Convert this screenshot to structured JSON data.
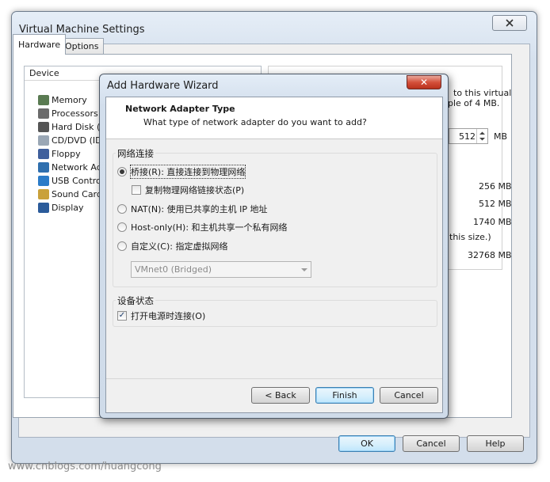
{
  "window": {
    "title": "Virtual Machine Settings",
    "tabs": [
      "Hardware",
      "Options"
    ],
    "device_header": "Device",
    "devices": [
      {
        "label": "Memory",
        "icon": "memory-icon",
        "color": "#5a7b52"
      },
      {
        "label": "Processors",
        "icon": "processor-icon",
        "color": "#6b6b6b"
      },
      {
        "label": "Hard Disk (S",
        "icon": "hard-disk-icon",
        "color": "#555555"
      },
      {
        "label": "CD/DVD (IDE",
        "icon": "cd-dvd-icon",
        "color": "#9aa7b5"
      },
      {
        "label": "Floppy",
        "icon": "floppy-icon",
        "color": "#3f5f9c"
      },
      {
        "label": "Network Ada",
        "icon": "network-adapter-icon",
        "color": "#2f6fae"
      },
      {
        "label": "USB Controll",
        "icon": "usb-icon",
        "color": "#2c7cc8"
      },
      {
        "label": "Sound Card",
        "icon": "sound-card-icon",
        "color": "#c9a13a"
      },
      {
        "label": "Display",
        "icon": "display-icon",
        "color": "#2b5b9a"
      }
    ],
    "memory_text_1": "to this virtual",
    "memory_text_2": "ple of 4 MB.",
    "memory_value": "512",
    "memory_unit": "MB",
    "mem_values": [
      "256 MB",
      "512 MB",
      "1740 MB",
      "this size.)",
      "32768 MB"
    ],
    "buttons": {
      "ok": "OK",
      "cancel": "Cancel",
      "help": "Help"
    }
  },
  "wizard": {
    "title": "Add Hardware Wizard",
    "close_symbol": "✕",
    "header_title": "Network Adapter Type",
    "header_subtitle": "What type of network adapter do you want to add?",
    "group_network": "网络连接",
    "bridged": "桥接(R): 直接连接到物理网络",
    "replicate": "复制物理网络链接状态(P)",
    "nat": "NAT(N): 使用已共享的主机 IP 地址",
    "host_only": "Host-only(H): 和主机共享一个私有网络",
    "custom": "自定义(C): 指定虚拟网络",
    "vmnet_select": "VMnet0 (Bridged)",
    "group_device": "设备状态",
    "connect_power": "打开电源时连接(O)",
    "check_mark": "✓",
    "buttons": {
      "back": "< Back",
      "finish": "Finish",
      "cancel": "Cancel"
    }
  },
  "watermark": "www.cnblogs.com/huangcong"
}
